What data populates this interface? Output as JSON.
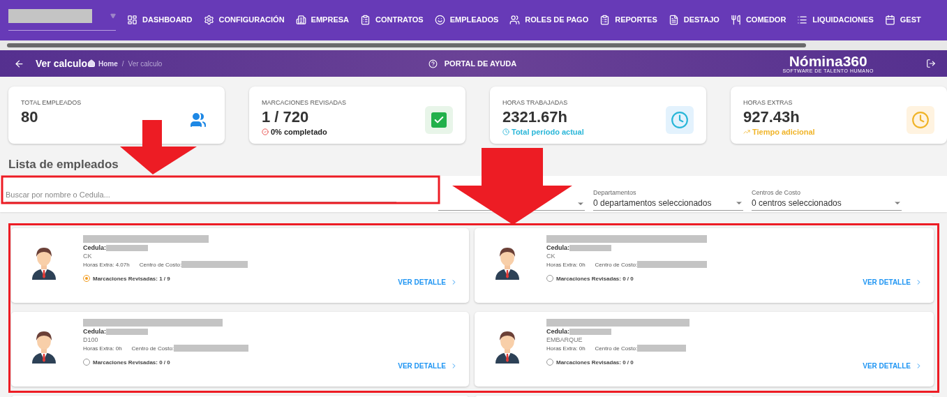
{
  "nav": {
    "menu": [
      {
        "label": "DASHBOARD"
      },
      {
        "label": "CONFIGURACIÓN"
      },
      {
        "label": "EMPRESA"
      },
      {
        "label": "CONTRATOS"
      },
      {
        "label": "EMPLEADOS"
      },
      {
        "label": "ROLES DE PAGO"
      },
      {
        "label": "REPORTES"
      },
      {
        "label": "DESTAJO"
      },
      {
        "label": "COMEDOR"
      },
      {
        "label": "LIQUIDACIONES"
      },
      {
        "label": "GEST"
      }
    ]
  },
  "header": {
    "title": "Ver calculo",
    "breadcrumb": [
      "Home",
      "/",
      "Ver calculo"
    ],
    "help": "PORTAL DE AYUDA",
    "logo": "Nómina360",
    "tagline": "SOFTWARE DE TALENTO HUMANO"
  },
  "stats": [
    {
      "label": "TOTAL EMPLEADOS",
      "value": "80",
      "kind": "users"
    },
    {
      "label": "MARCACIONES REVISADAS",
      "value": "1 / 720",
      "note": "0% completado",
      "kind": "check"
    },
    {
      "label": "HORAS TRABAJADAS",
      "value": "2321.67h",
      "note": "Total período actual",
      "kind": "clock"
    },
    {
      "label": "HORAS EXTRAS",
      "value": "927.43h",
      "note": "Tiempo adicional",
      "kind": "extra"
    }
  ],
  "list_title": "Lista de empleados",
  "filters": {
    "search_placeholder": "Buscar por nombre o Cedula...",
    "selects": [
      {
        "label": "Departamentos",
        "value": "0 departamentos seleccionados"
      },
      {
        "label": "Centros de Costo",
        "value": "0 centros seleccionados"
      }
    ]
  },
  "employees": [
    {
      "cedula_label": "Cedula:",
      "area": "CK",
      "extra": "Horas Extra: 4.07h",
      "cost_label": "Centro de Costo:",
      "reviewed": "Marcaciones Revisadas: 1 / 9",
      "started": true,
      "action": "VER DETALLE"
    },
    {
      "cedula_label": "Cedula:",
      "area": "CK",
      "extra": "Horas Extra: 0h",
      "cost_label": "Centro de Costo:",
      "reviewed": "Marcaciones Revisadas: 0 / 0",
      "started": false,
      "action": "VER DETALLE"
    },
    {
      "cedula_label": "Cedula:",
      "area": "D100",
      "extra": "Horas Extra: 0h",
      "cost_label": "Centro de Costo:",
      "reviewed": "Marcaciones Revisadas: 0 / 0",
      "started": false,
      "action": "VER DETALLE"
    },
    {
      "cedula_label": "Cedula:",
      "area": "EMBARQUE",
      "extra": "Horas Extra: 0h",
      "cost_label": "Centro de Costo:",
      "reviewed": "Marcaciones Revisadas: 0 / 0",
      "started": false,
      "action": "VER DETALLE"
    }
  ]
}
